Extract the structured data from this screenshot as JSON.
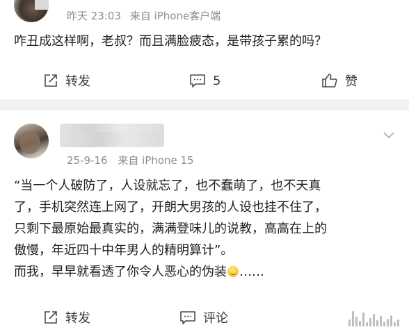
{
  "post1": {
    "meta": {
      "time": "昨天 23:03",
      "source": "来自 iPhone客户端"
    },
    "content": "咋丑成这样啊，老叔？而且满脸疲态，是带孩子累的吗？",
    "actions": {
      "repost": "转发",
      "comments": "5",
      "like": "赞"
    }
  },
  "post2": {
    "meta": {
      "date": "25-9-16",
      "source": "来自 iPhone 15"
    },
    "content_lines": [
      "“当一个人破防了，人设就忘了，也不蠢萌了，也不天真",
      "了，手机突然连上网了，开朗大男孩的人设也挂不住了，",
      "只剩下最原始最真实的，满满登味儿的说教，高高在上的",
      "傲慢，年近四十中年男人的精明算计”。"
    ],
    "last_line_before_emoji": "而我，早早就看透了你令人恶心的伪装",
    "last_line_after_emoji": "……",
    "actions": {
      "repost": "转发",
      "comment": "评论"
    }
  },
  "icons": {
    "repost": "repost-icon",
    "comment": "comment-icon",
    "like": "thumbs-up-icon",
    "more": "chevron-down-icon",
    "emoji": "smirk-emoji-icon"
  }
}
